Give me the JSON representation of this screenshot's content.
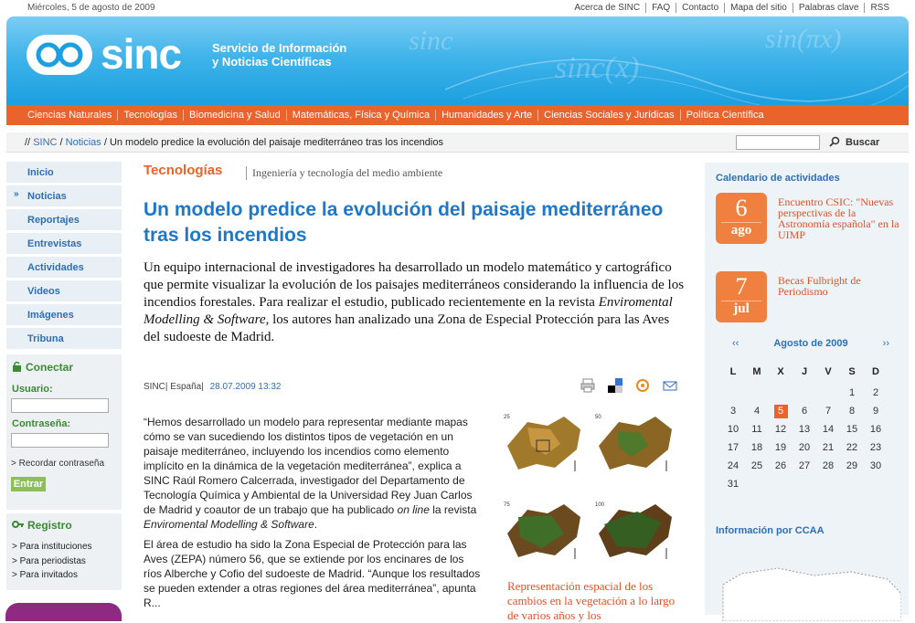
{
  "topbar": {
    "date": "Miércoles, 5 de agosto de 2009",
    "links": [
      "Acerca de SINC",
      "FAQ",
      "Contacto",
      "Mapa del sitio",
      "Palabras clave",
      "RSS"
    ]
  },
  "header": {
    "logo": "sinc",
    "subtitle_1": "Servicio de Información",
    "subtitle_2": "y Noticias Científicas"
  },
  "nav": [
    "Ciencias Naturales",
    "Tecnologías",
    "Biomedicina y Salud",
    "Matemáticas, Física y Química",
    "Humanidades y Arte",
    "Ciencias Sociales y Jurídicas",
    "Política Científica"
  ],
  "breadcrumb": {
    "prefix": "//",
    "home": "SINC",
    "section": "Noticias",
    "current": "Un modelo predice la evolución del paisaje mediterráneo tras los incendios"
  },
  "search": {
    "button": "Buscar"
  },
  "sidebar": {
    "items": [
      "Inicio",
      "Noticias",
      "Reportajes",
      "Entrevistas",
      "Actividades",
      "Videos",
      "Imágenes",
      "Tribuna"
    ]
  },
  "login": {
    "title": "Conectar",
    "user_label": "Usuario:",
    "pass_label": "Contraseña:",
    "remember": "> Recordar contraseña",
    "submit": "Entrar"
  },
  "registro": {
    "title": "Registro",
    "links": [
      "> Para instituciones",
      "> Para periodistas",
      "> Para invitados"
    ]
  },
  "article": {
    "section": "Tecnologías",
    "subsection": "Ingeniería y tecnología del medio ambiente",
    "title": "Un modelo predice la evolución del paisaje mediterráneo tras los incendios",
    "lead_1": "Un equipo internacional de investigadores ha desarrollado un modelo matemático y cartográfico que permite visualizar la evolución de los paisajes mediterráneos considerando la influencia de los incendios forestales. Para realizar el estudio, publicado recientemente en la revista ",
    "lead_journal": "Enviromental Modelling & Software",
    "lead_2": ", los autores han analizado una Zona de Especial Protección para las Aves del sudoeste de Madrid.",
    "source": "SINC",
    "country": "España",
    "date": "28.07.2009 13:32",
    "p1_a": "“Hemos desarrollado un modelo para representar mediante mapas cómo se van sucediendo los distintos tipos de vegetación en un paisaje mediterráneo, incluyendo los incendios como elemento implícito en la dinámica de la vegetación mediterránea”, explica a SINC Raúl Romero Calcerrada, investigador del Departamento de Tecnología Química y Ambiental de la Universidad Rey Juan Carlos de Madrid y coautor de un trabajo que ha publicado ",
    "p1_online": "on line",
    "p1_b": " la revista ",
    "p1_journal": "Enviromental Modelling & Software",
    "p1_c": ".",
    "p2": "El área de estudio ha sido la Zona Especial de Protección para las Aves (ZEPA) número 56, que se extiende por los encinares de los ríos Alberche y Cofio del sudoeste de Madrid. “Aunque los resultados se pueden extender a otras regiones del área mediterránea”, apunta R...",
    "fig_labels": [
      "25",
      "50",
      "75",
      "100"
    ],
    "caption": "Representación espacial de los cambios en la vegetación a lo largo de varios años y los"
  },
  "calendar_box": {
    "title": "Calendario de actividades",
    "events": [
      {
        "day": "6",
        "month": "ago",
        "text": "Encuentro CSIC: \"Nuevas perspectivas de la Astronomía española\" en la UIMP"
      },
      {
        "day": "7",
        "month": "jul",
        "text": "Becas Fulbright de Periodismo"
      }
    ],
    "month": "Agosto de 2009",
    "prev": "‹‹",
    "next": "››",
    "weekdays": [
      "L",
      "M",
      "X",
      "J",
      "V",
      "S",
      "D"
    ],
    "weeks": [
      [
        "",
        "",
        "",
        "",
        "",
        "1",
        "2"
      ],
      [
        "3",
        "4",
        "5",
        "6",
        "7",
        "8",
        "9"
      ],
      [
        "10",
        "11",
        "12",
        "13",
        "14",
        "15",
        "16"
      ],
      [
        "17",
        "18",
        "19",
        "20",
        "21",
        "22",
        "23"
      ],
      [
        "24",
        "25",
        "26",
        "27",
        "28",
        "29",
        "30"
      ],
      [
        "31",
        "",
        "",
        "",
        "",
        "",
        ""
      ]
    ],
    "today": "5"
  },
  "ccaa": {
    "title": "Información por CCAA"
  },
  "colors": {
    "orange": "#e9632a",
    "blue": "#1e78c8",
    "green": "#3b8a34"
  }
}
